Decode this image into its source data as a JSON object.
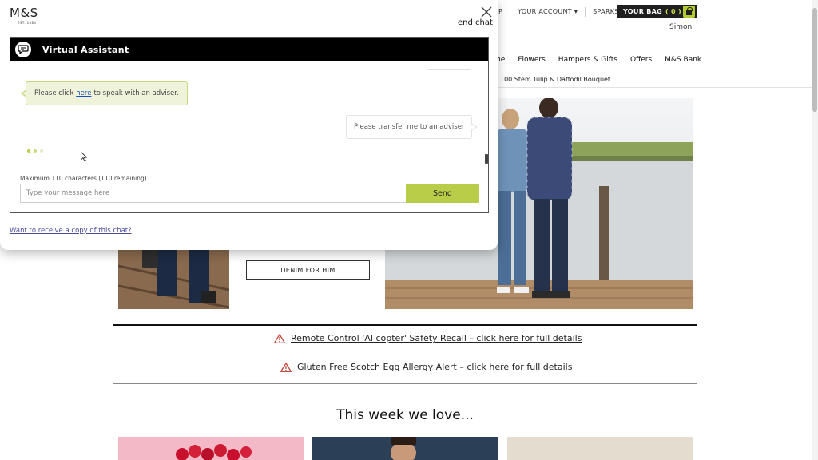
{
  "site": {
    "topbar": {
      "store_fragment": "P",
      "your_account": "YOUR ACCOUNT",
      "sparks": "SPARKS"
    },
    "bag": {
      "label": "YOUR BAG",
      "count": "( 0 )"
    },
    "user_name": "Simon",
    "nav": [
      "me",
      "Flowers",
      "Hampers & Gifts",
      "Offers",
      "M&S Bank"
    ],
    "subnav": "100 Stem Tulip & Daffodil Bouquet",
    "denim_button": "DENIM FOR HIM",
    "alerts": [
      "Remote Control 'AI copter' Safety Recall – click here for full details",
      "Gluten Free Scotch Egg Allergy Alert – click here for full details"
    ],
    "week_title": "This week we love..."
  },
  "chat": {
    "logo": "M&S",
    "logo_sub": "EST. 1884",
    "end_chat": "end chat",
    "title": "Virtual Assistant",
    "bot_message": {
      "before": "Please click",
      "link": "here",
      "after": "to speak with an adviser."
    },
    "user_message": "Please transfer me to an adviser",
    "char_limit": "Maximum 110 characters (110 remaining)",
    "input_placeholder": "Type your message here",
    "input_value": "",
    "send_label": "Send",
    "copy_link": "Want to receive a copy of this chat?"
  },
  "colors": {
    "accent_green": "#b9cd48",
    "bot_bubble_bg": "#eef3d9",
    "header_black": "#000000",
    "alert_red": "#c0392b"
  }
}
